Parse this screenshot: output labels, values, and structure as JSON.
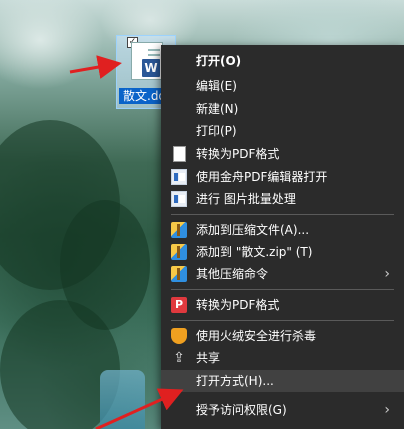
{
  "file": {
    "name": "散文.do",
    "check": "✓",
    "badge": "W"
  },
  "menu": {
    "items": [
      {
        "label": "打开(O)",
        "bold": true
      },
      {
        "label": "编辑(E)"
      },
      {
        "label": "新建(N)"
      },
      {
        "label": "打印(P)"
      },
      {
        "label": "转换为PDF格式",
        "icon": "page-icon"
      },
      {
        "label": "使用金舟PDF编辑器打开",
        "icon": "app-window-icon"
      },
      {
        "label": "进行 图片批量处理",
        "icon": "app-window-icon"
      },
      {
        "label": "添加到压缩文件(A)...",
        "icon": "archive-icon"
      },
      {
        "label": "添加到 \"散文.zip\" (T)",
        "icon": "archive-icon"
      },
      {
        "label": "其他压缩命令",
        "icon": "archive-icon",
        "submenu_arrow": "›"
      },
      {
        "label": "转换为PDF格式",
        "icon": "pdf-convert-icon",
        "icon_text": "P"
      },
      {
        "label": "使用火绒安全进行杀毒",
        "icon": "shield-icon"
      },
      {
        "label": "共享",
        "icon": "share-icon",
        "icon_text": "⇪"
      },
      {
        "label": "打开方式(H)...",
        "highlighted": true
      },
      {
        "label": "授予访问权限(G)",
        "submenu_arrow": "›"
      }
    ]
  },
  "colors": {
    "menu_bg": "#2b2b2b",
    "highlight": "#414141",
    "annotation_arrow": "#e02020",
    "selection": "#0a63c9"
  }
}
